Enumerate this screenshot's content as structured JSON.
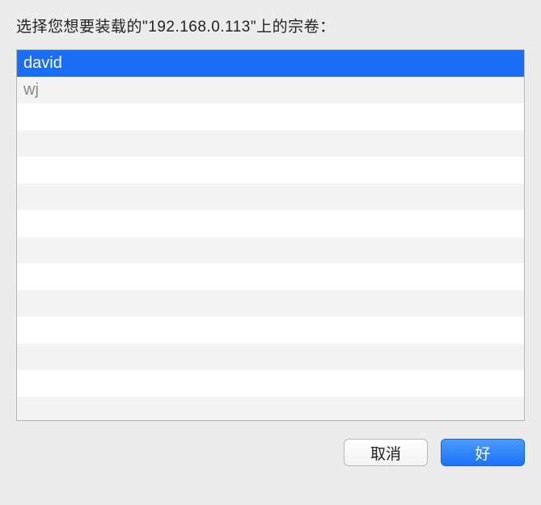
{
  "prompt": {
    "prefix": "选择您想要装载的\"",
    "host": "192.168.0.113",
    "suffix": "\"上的宗卷："
  },
  "volumes": [
    {
      "name": "david",
      "selected": true,
      "dimmed": false
    },
    {
      "name": "wj",
      "selected": false,
      "dimmed": true
    }
  ],
  "visibleRowCount": 14,
  "buttons": {
    "cancel": "取消",
    "ok": "好"
  }
}
